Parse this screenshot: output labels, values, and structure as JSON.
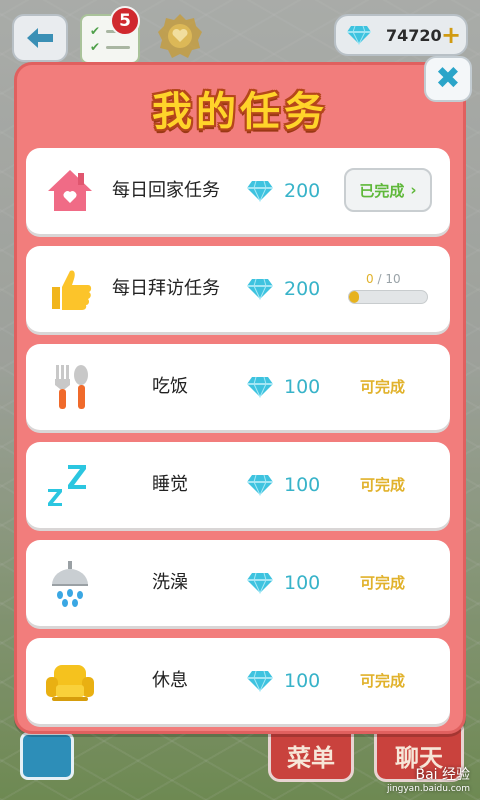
{
  "hud": {
    "task_badge_count": "5",
    "gems_value": "74720"
  },
  "bottom": {
    "menu_label": "菜单",
    "chat_label": "聊天",
    "watermark": "Bai 经验",
    "watermark_url": "jingyan.baidu.com"
  },
  "panel": {
    "title": "我的任务"
  },
  "tasks": [
    {
      "icon": "house-icon",
      "name": "每日回家任务",
      "reward": "200",
      "status": "已完成"
    },
    {
      "icon": "thumbs-up-icon",
      "name": "每日拜访任务",
      "reward": "200",
      "progress_current": "0",
      "progress_sep": "/",
      "progress_total": "10",
      "progress_fraction": 0.0
    },
    {
      "icon": "fork-spoon-icon",
      "name": "吃饭",
      "reward": "100",
      "status": "可完成"
    },
    {
      "icon": "sleep-zz-icon",
      "name": "睡觉",
      "reward": "100",
      "status": "可完成"
    },
    {
      "icon": "shower-icon",
      "name": "洗澡",
      "reward": "100",
      "status": "可完成"
    },
    {
      "icon": "armchair-icon",
      "name": "休息",
      "reward": "100",
      "status": "可完成"
    }
  ],
  "colors": {
    "panel": "#f27d7c",
    "title": "#ffd42a",
    "gem": "#38b3c9",
    "done_text": "#5fb83a",
    "available_text": "#e1b22c"
  }
}
